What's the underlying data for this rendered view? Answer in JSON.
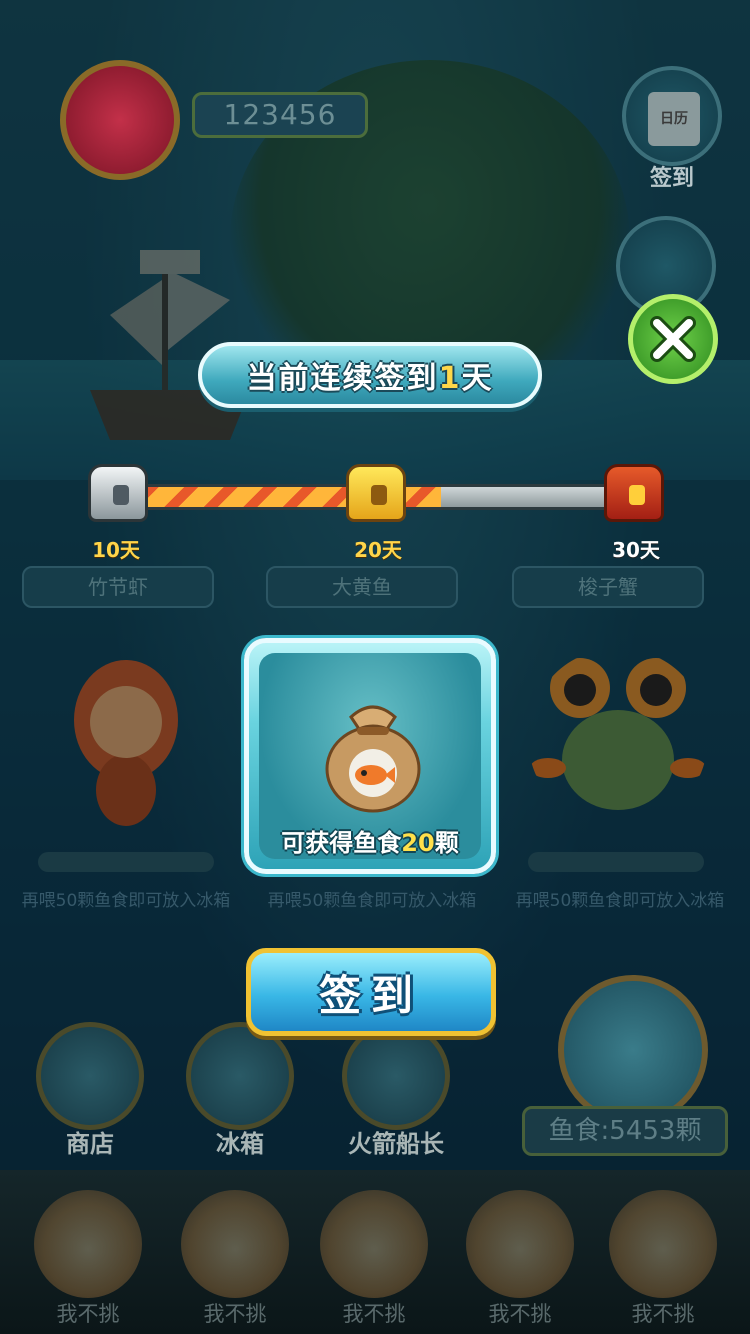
{
  "hud": {
    "score": "123456",
    "checkin_label": "签到",
    "calendar_label": "日历"
  },
  "popup": {
    "title_prefix": "当前连续签到",
    "title_days": "1",
    "title_suffix": "天",
    "progress": {
      "current_days": 1,
      "max_days": 30,
      "fill_fraction": 0.62
    },
    "milestones": [
      "10天",
      "20天",
      "30天"
    ],
    "reward_prefix": "可获得鱼食",
    "reward_amount": "20",
    "reward_suffix": "颗",
    "sign_button": "签到"
  },
  "cards": [
    {
      "name": "竹节虾",
      "note": "再喂50颗鱼食即可放入冰箱"
    },
    {
      "name": "大黄鱼",
      "note": "再喂50颗鱼食即可放入冰箱"
    },
    {
      "name": "梭子蟹",
      "note": "再喂50颗鱼食即可放入冰箱"
    }
  ],
  "bottom_nav": {
    "shop": "商店",
    "fridge": "冰箱",
    "captain": "火箭船长",
    "fish_food": "鱼食:5453颗"
  },
  "friends": [
    "我不挑",
    "我不挑",
    "我不挑",
    "我不挑",
    "我不挑"
  ],
  "colors": {
    "accent_gold": "#ffd54a",
    "close_green": "#2d8a1e",
    "popup_teal": "#3fa9bd"
  }
}
